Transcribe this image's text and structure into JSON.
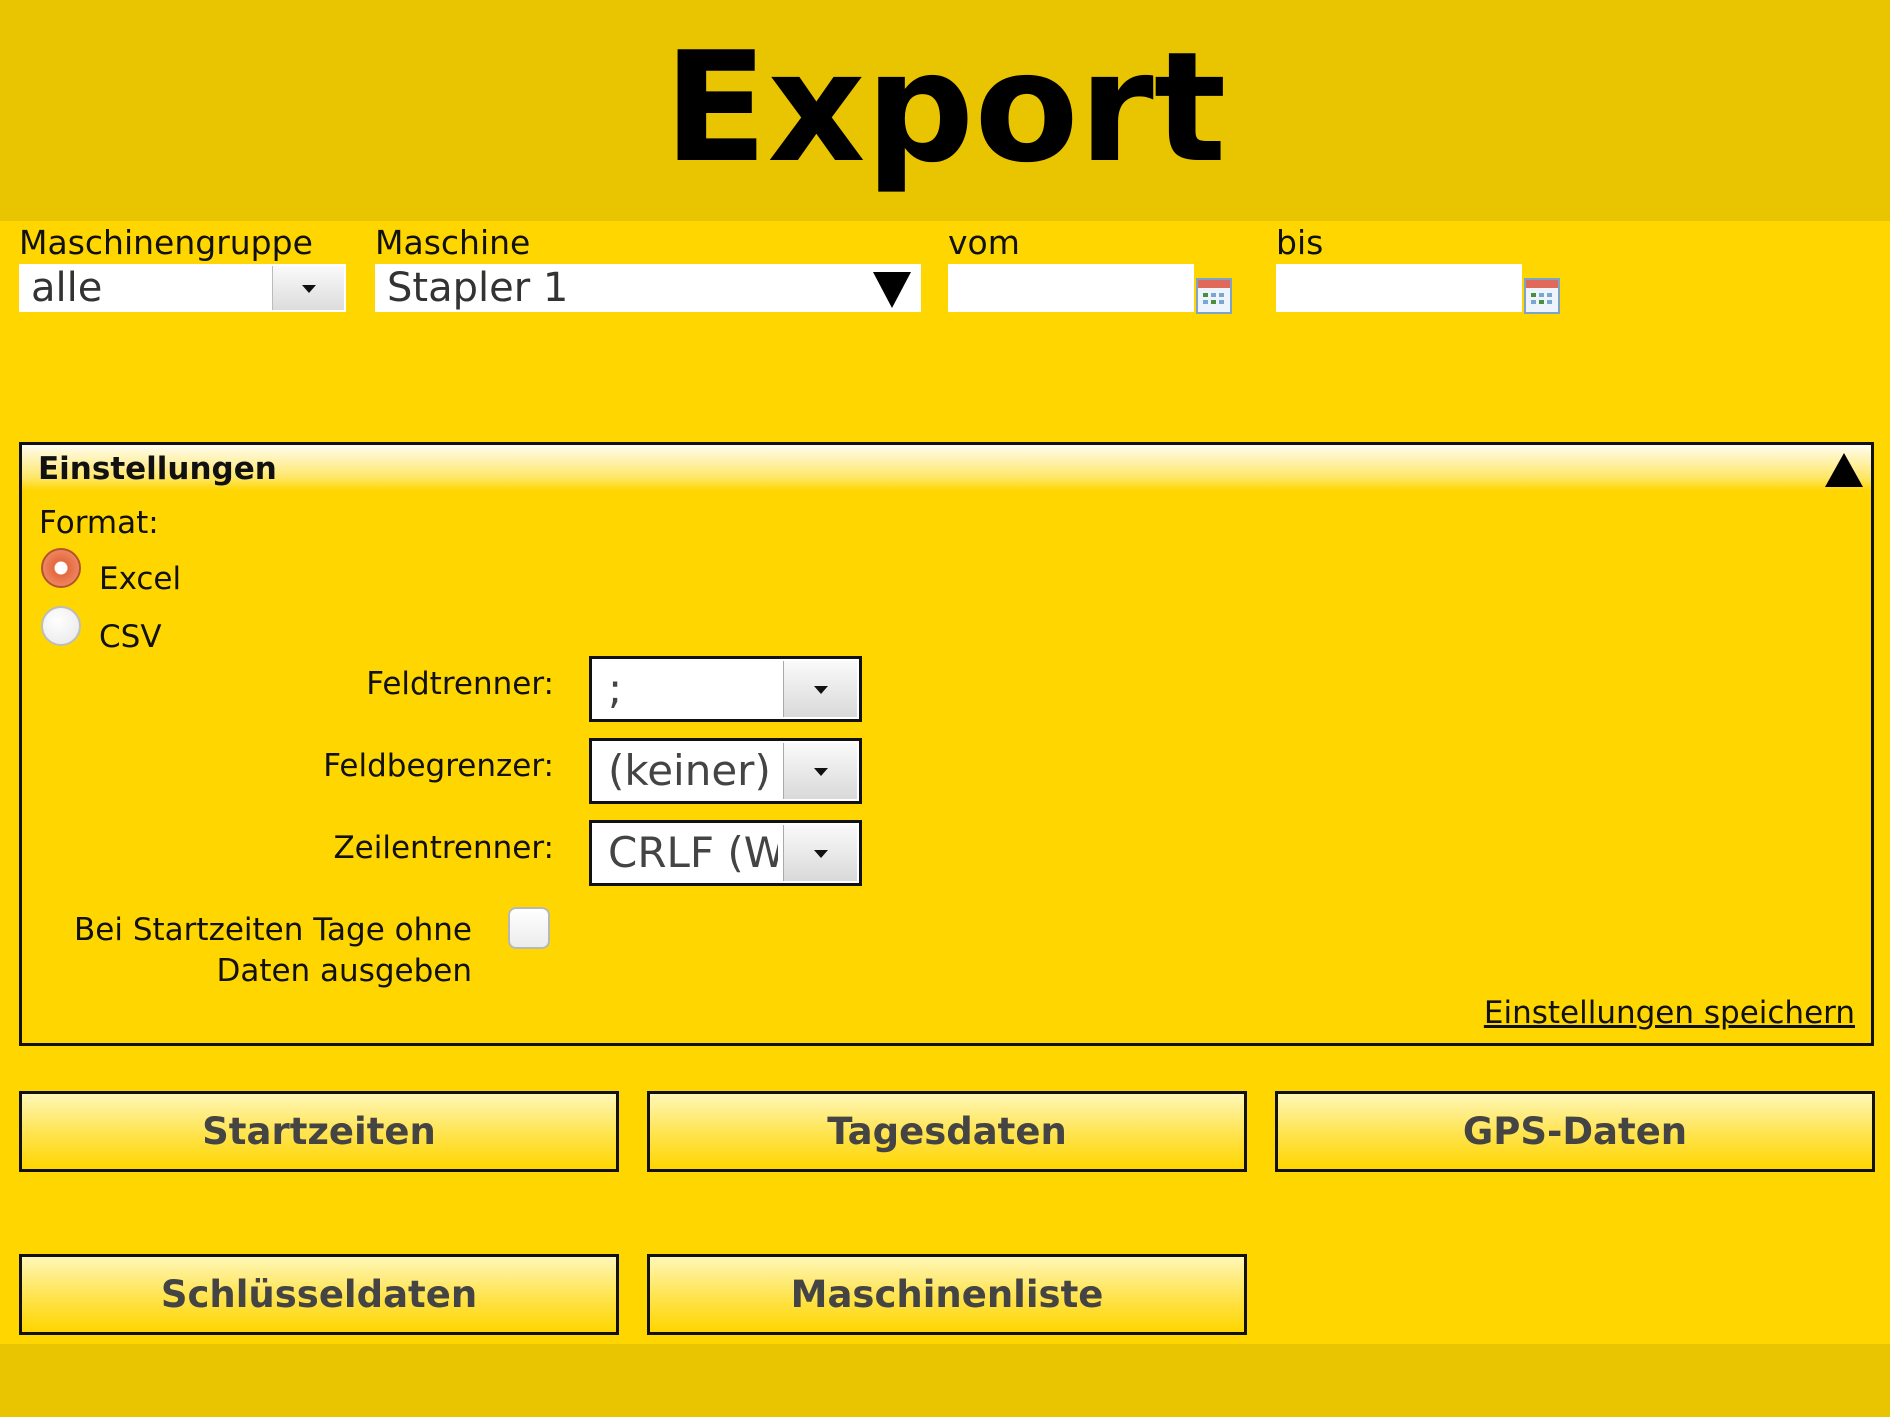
{
  "header": {
    "title": "Export"
  },
  "filters": {
    "machine_group": {
      "label": "Maschinengruppe",
      "value": "alle"
    },
    "machine": {
      "label": "Maschine",
      "value": "Stapler 1"
    },
    "from": {
      "label": "vom",
      "value": ""
    },
    "to": {
      "label": "bis",
      "value": ""
    }
  },
  "settings": {
    "title": "Einstellungen",
    "format_label": "Format:",
    "formats": [
      {
        "label": "Excel",
        "selected": true
      },
      {
        "label": "CSV",
        "selected": false
      }
    ],
    "field_separator": {
      "label": "Feldtrenner:",
      "value": ";"
    },
    "field_delimiter": {
      "label": "Feldbegrenzer:",
      "value": "(keiner)"
    },
    "line_separator": {
      "label": "Zeilentrenner:",
      "value": "CRLF (Windows)"
    },
    "empty_days": {
      "label_line1": "Bei Startzeiten Tage ohne",
      "label_line2": "Daten ausgeben",
      "checked": false
    },
    "save_link": "Einstellungen speichern"
  },
  "actions": {
    "start_times": "Startzeiten",
    "daily_data": "Tagesdaten",
    "gps_data": "GPS-Daten",
    "key_data": "Schlüsseldaten",
    "machine_list": "Maschinenliste"
  },
  "colors": {
    "background": "#ffd600",
    "header": "#e9c400",
    "radio_selected": "#e4683f"
  }
}
